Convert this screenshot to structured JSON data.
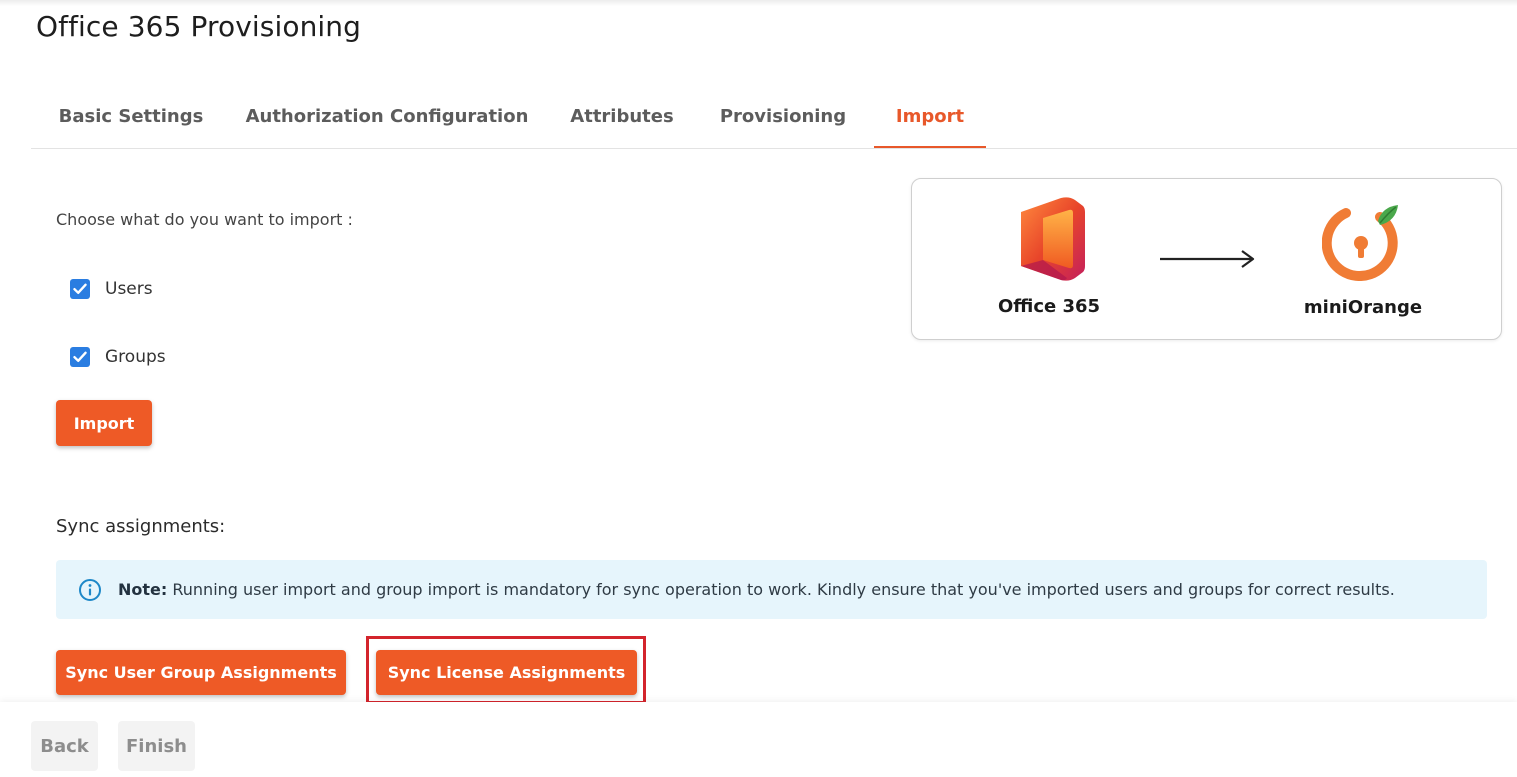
{
  "page": {
    "title": "Office 365 Provisioning"
  },
  "tabs": [
    {
      "label": "Basic Settings",
      "active": false
    },
    {
      "label": "Authorization Configuration",
      "active": false
    },
    {
      "label": "Attributes",
      "active": false
    },
    {
      "label": "Provisioning",
      "active": false
    },
    {
      "label": "Import",
      "active": true
    }
  ],
  "import_section": {
    "prompt": "Choose what do you want to import :",
    "options": [
      {
        "label": "Users",
        "checked": true
      },
      {
        "label": "Groups",
        "checked": true
      }
    ],
    "import_button": "Import"
  },
  "diagram": {
    "source_label": "Office 365",
    "target_label": "miniOrange",
    "source_icon": "office365-logo-icon",
    "arrow_icon": "arrow-right-icon",
    "target_icon": "miniorange-logo-icon"
  },
  "sync_section": {
    "title": "Sync assignments:",
    "note_label": "Note:",
    "note_text": " Running user import and group import is mandatory for sync operation to work. Kindly ensure that you've imported users and groups for correct results.",
    "sync_user_group_button": "Sync User Group Assignments",
    "sync_license_button": "Sync License Assignments"
  },
  "footer": {
    "back_button": "Back",
    "finish_button": "Finish"
  },
  "colors": {
    "accent": "#ee5a26",
    "tab_active": "#e8582a",
    "checkbox": "#2a7de1",
    "note_bg": "#e6f5fc",
    "highlight": "#d3242c"
  }
}
